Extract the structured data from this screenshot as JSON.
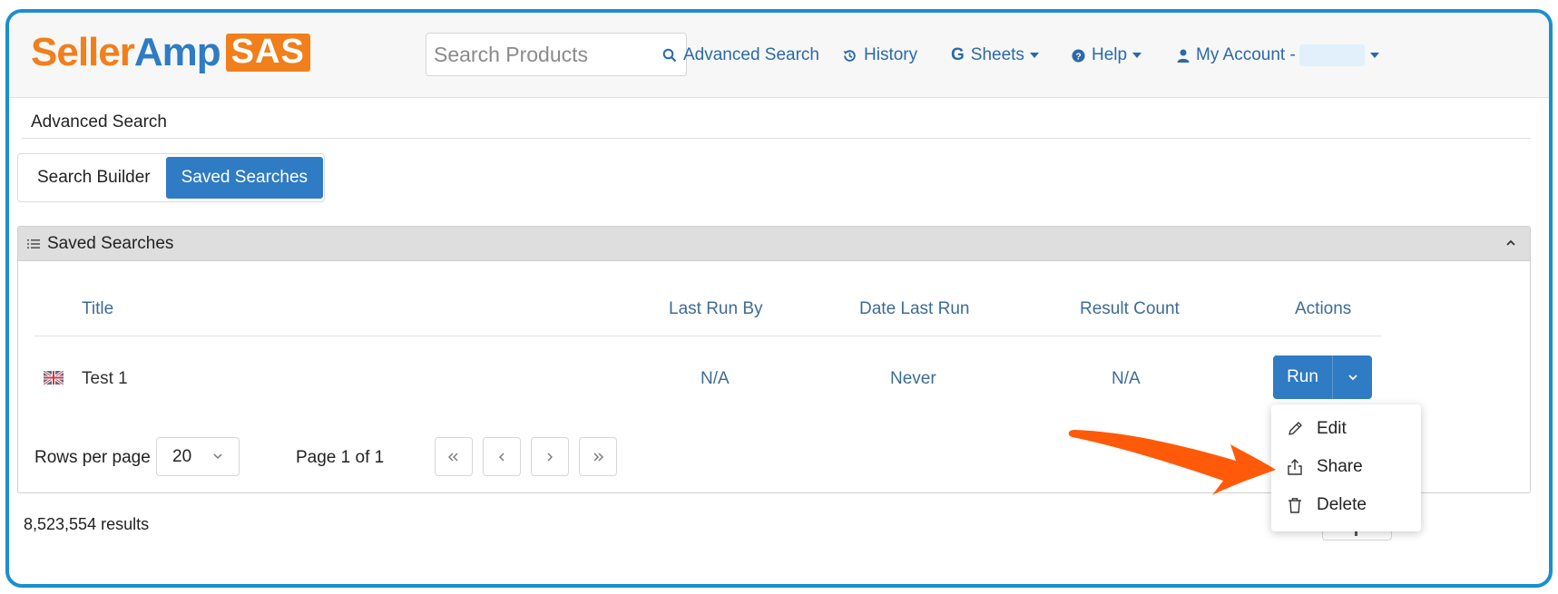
{
  "brand": {
    "logo_seller": "Seller",
    "logo_amp": "Amp",
    "logo_badge": "SAS",
    "orange": "#f07f1c",
    "blue": "#2f7bc4"
  },
  "search": {
    "placeholder": "Search Products"
  },
  "nav": {
    "advanced_search": "Advanced Search",
    "history": "History",
    "sheets": "Sheets",
    "help": "Help",
    "my_account": "My Account -"
  },
  "breadcrumb": "Advanced Search",
  "tabs": [
    {
      "label": "Search Builder",
      "active": false
    },
    {
      "label": "Saved Searches",
      "active": true
    }
  ],
  "panel": {
    "title": "Saved Searches"
  },
  "table": {
    "headers": {
      "title": "Title",
      "last_run_by": "Last Run By",
      "date_last_run": "Date Last Run",
      "result_count": "Result Count",
      "actions": "Actions"
    },
    "rows": [
      {
        "flag": "uk-flag-icon",
        "title": "Test 1",
        "last_run_by": "N/A",
        "date_last_run": "Never",
        "result_count": "N/A",
        "action": "Run"
      }
    ]
  },
  "pagination": {
    "rows_label": "Rows per page",
    "rows_value": "20",
    "page_label": "Page 1 of 1"
  },
  "results": "8,523,554 results",
  "dropdown": {
    "edit": "Edit",
    "share": "Share",
    "delete": "Delete"
  },
  "annotation": {
    "arrow_color": "#ff5a0a"
  }
}
